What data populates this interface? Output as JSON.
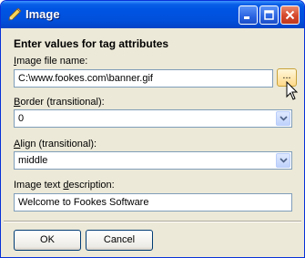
{
  "window": {
    "title": "Image",
    "icon": "pencil-icon"
  },
  "form": {
    "heading": "Enter values for tag attributes",
    "image_file": {
      "label_prefix": "",
      "label_accel": "I",
      "label_rest": "mage file name:",
      "value": "C:\\www.fookes.com\\banner.gif",
      "browse_label": "..."
    },
    "border": {
      "label_accel": "B",
      "label_rest": "order (transitional):",
      "value": "0"
    },
    "align": {
      "label_accel": "A",
      "label_rest": "lign (transitional):",
      "value": "middle"
    },
    "alt": {
      "label_pre": "Image text ",
      "label_accel": "d",
      "label_rest": "escription:",
      "value": "Welcome to Fookes Software"
    }
  },
  "buttons": {
    "ok": "OK",
    "cancel": "Cancel"
  }
}
